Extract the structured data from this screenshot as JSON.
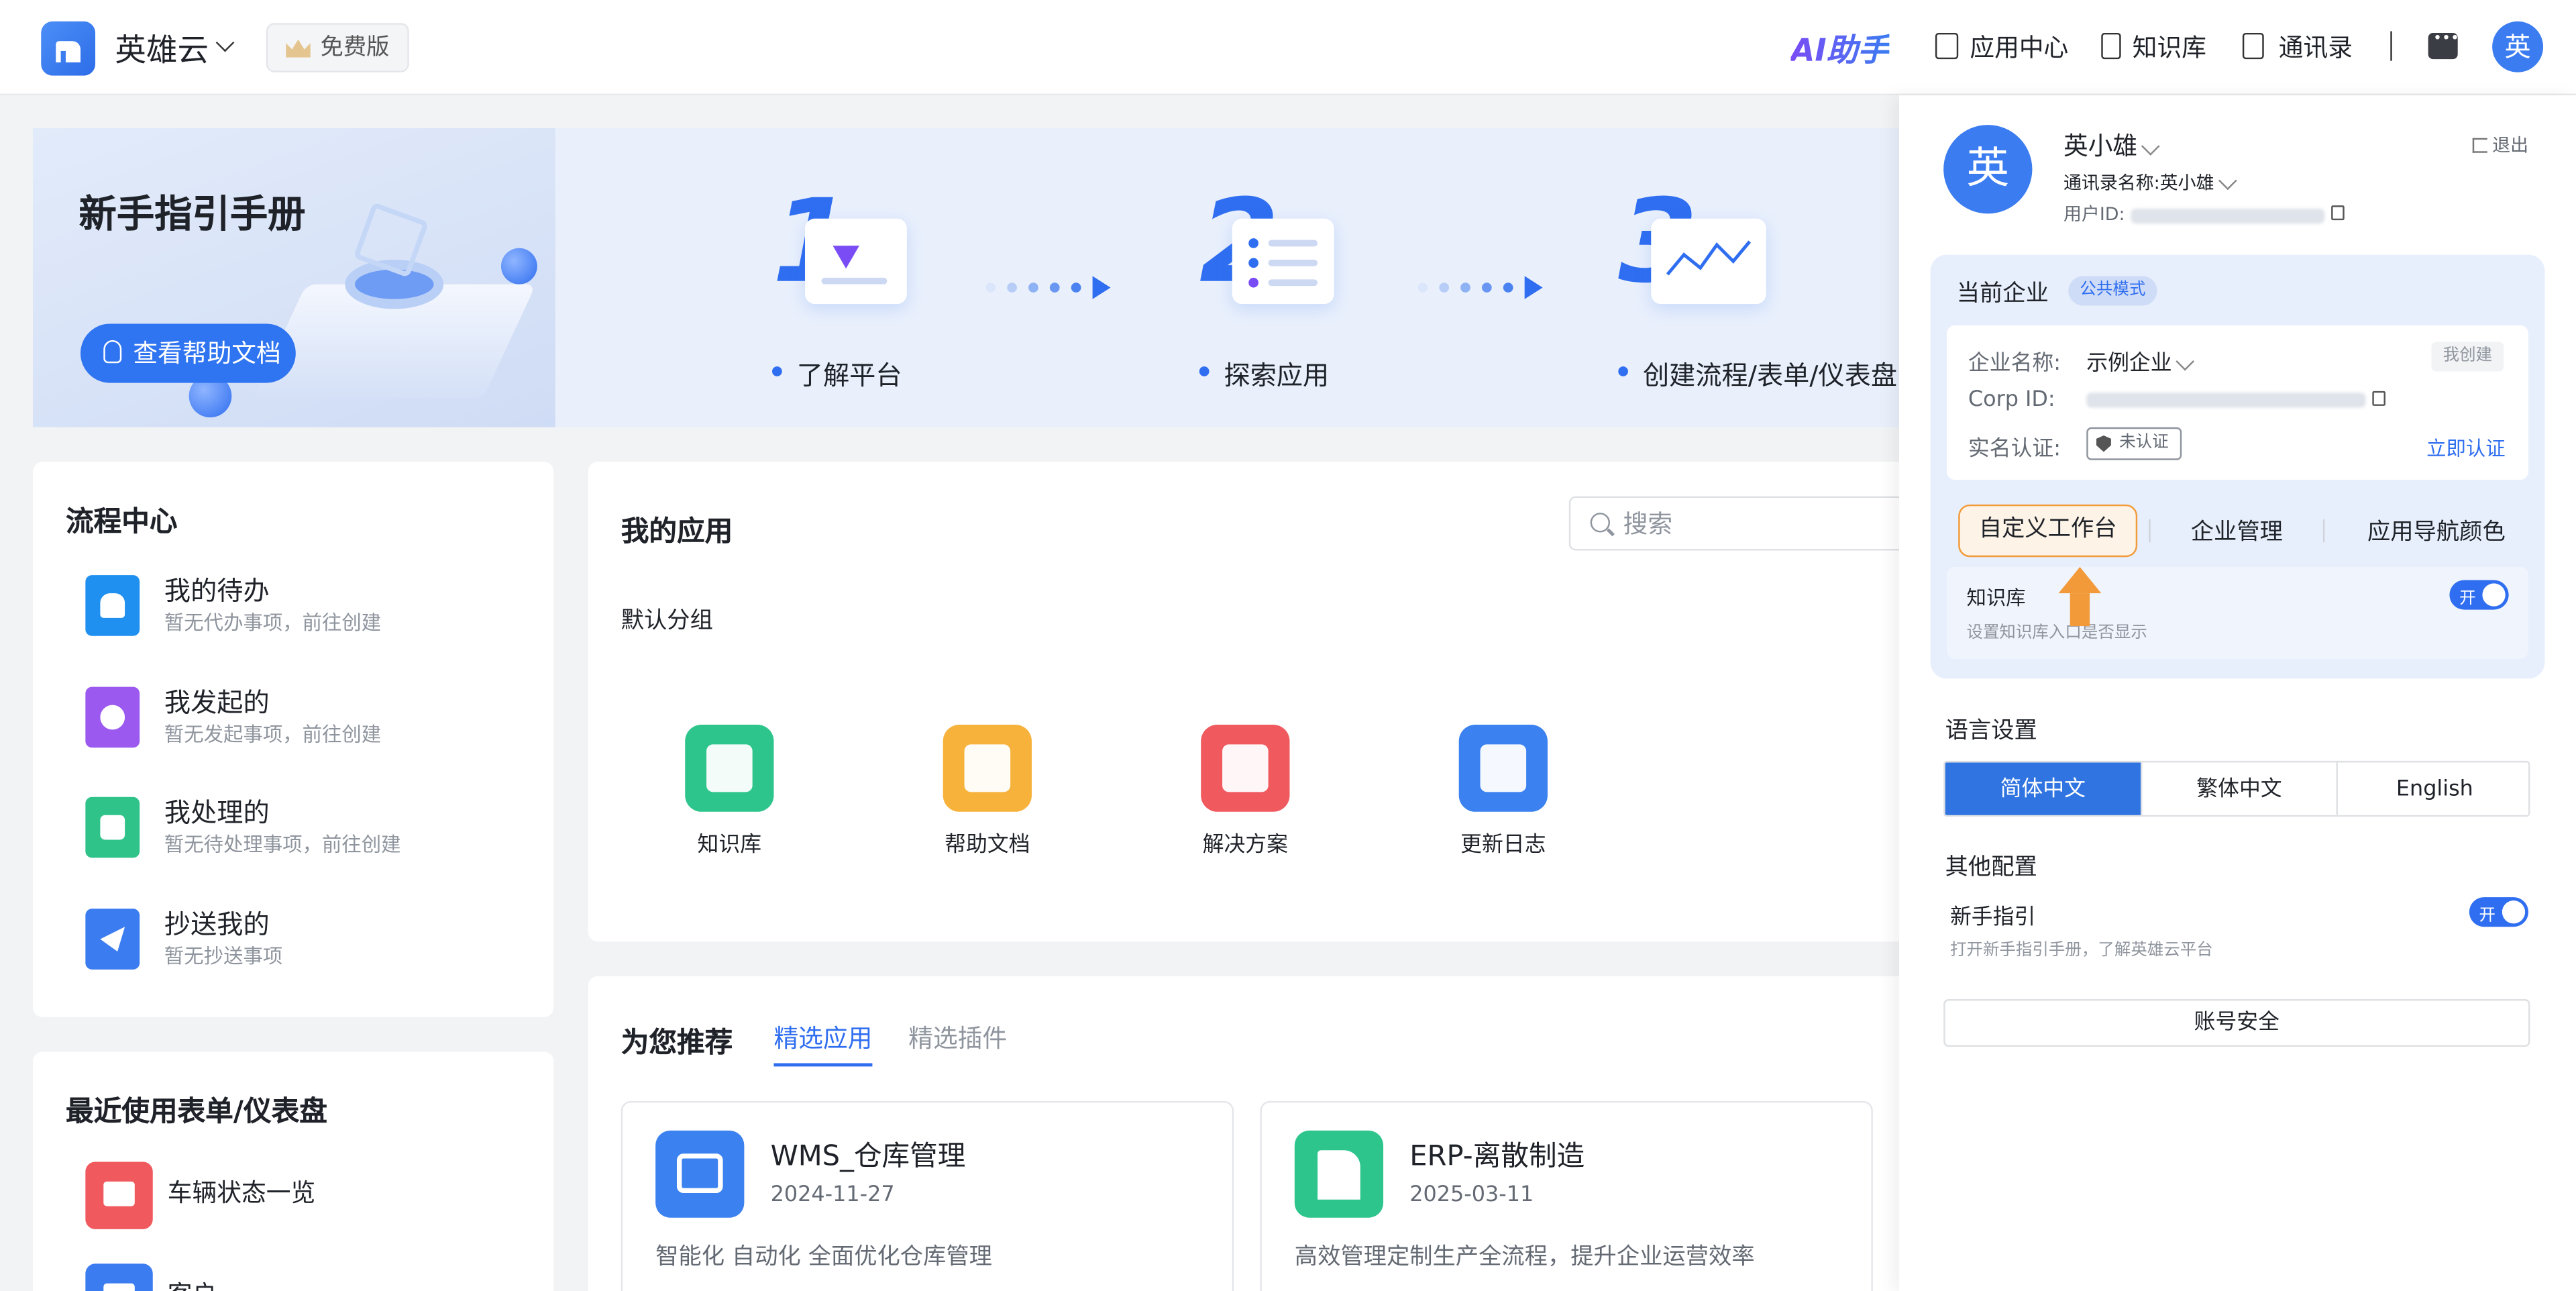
{
  "header": {
    "brand": "英雄云",
    "plan_badge": "免费版",
    "ai_assistant": "AI助手",
    "nav": [
      {
        "label": "应用中心",
        "icon": "app-center-icon"
      },
      {
        "label": "知识库",
        "icon": "book-icon"
      },
      {
        "label": "通讯录",
        "icon": "contacts-icon"
      }
    ],
    "user_initial": "英"
  },
  "banner": {
    "title": "新手指引手册",
    "help_button": "查看帮助文档",
    "steps": [
      {
        "num": "1",
        "label": "了解平台"
      },
      {
        "num": "2",
        "label": "探索应用"
      },
      {
        "num": "3",
        "label": "创建流程/表单/仪表盘"
      }
    ]
  },
  "flow_center": {
    "title": "流程中心",
    "items": [
      {
        "name": "我的待办",
        "sub": "暂无代办事项，前往创建",
        "icon": "bell-icon",
        "color": "#1f8ff0"
      },
      {
        "name": "我发起的",
        "sub": "暂无发起事项，前往创建",
        "icon": "play-icon",
        "color": "#9b59f0"
      },
      {
        "name": "我处理的",
        "sub": "暂无待处理事项，前往创建",
        "icon": "task-icon",
        "color": "#2fc38a"
      },
      {
        "name": "抄送我的",
        "sub": "暂无抄送事项",
        "icon": "send-icon",
        "color": "#3b7cf0"
      }
    ]
  },
  "recent": {
    "title": "最近使用表单/仪表盘",
    "items": [
      {
        "name": "车辆状态一览",
        "icon": "dashboard-icon",
        "color": "#f0595e"
      },
      {
        "name": "客户",
        "icon": "form-icon",
        "color": "#3b7cf0"
      }
    ]
  },
  "my_apps": {
    "title": "我的应用",
    "search_placeholder": "搜索",
    "group": "默认分组",
    "apps": [
      {
        "name": "知识库",
        "icon": "knowledge-icon",
        "color": "#2ec58d"
      },
      {
        "name": "帮助文档",
        "icon": "help-doc-icon",
        "color": "#f7b23b"
      },
      {
        "name": "解决方案",
        "icon": "solution-icon",
        "color": "#f0595e"
      },
      {
        "name": "更新日志",
        "icon": "changelog-icon",
        "color": "#3b82f0"
      }
    ]
  },
  "recommend": {
    "title": "为您推荐",
    "tabs": [
      "精选应用",
      "精选插件"
    ],
    "active_tab": "精选应用",
    "cards": [
      {
        "title": "WMS_仓库管理",
        "date": "2024-11-27",
        "desc": "智能化 自动化 全面优化仓库管理",
        "icon": "warehouse-icon",
        "color": "#3b82f0"
      },
      {
        "title": "ERP-离散制造",
        "date": "2025-03-11",
        "desc": "高效管理定制生产全流程，提升企业运营效率",
        "icon": "factory-icon",
        "color": "#2ec58d"
      }
    ]
  },
  "panel": {
    "user_name": "英小雄",
    "contact_name": "通讯录名称:英小雄",
    "user_id_label": "用户ID:",
    "logout": "退出",
    "avatar": "英",
    "enterprise": {
      "title": "当前企业",
      "mode": "公共模式",
      "name_label": "企业名称:",
      "name_value": "示例企业",
      "created_tag": "我创建",
      "corp_label": "Corp ID:",
      "verify_label": "实名认证:",
      "verify_status": "未认证",
      "verify_link": "立即认证",
      "tabs": [
        "自定义工作台",
        "企业管理",
        "应用导航颜色"
      ],
      "kb_title": "知识库",
      "kb_sub": "设置知识库入口是否显示",
      "kb_toggle": "开"
    },
    "language": {
      "title": "语言设置",
      "options": [
        "简体中文",
        "繁体中文",
        "English"
      ],
      "selected": "简体中文"
    },
    "other": {
      "title": "其他配置",
      "guide_name": "新手指引",
      "guide_sub": "打开新手指引手册，了解英雄云平台",
      "guide_toggle": "开"
    },
    "account_security": "账号安全"
  }
}
